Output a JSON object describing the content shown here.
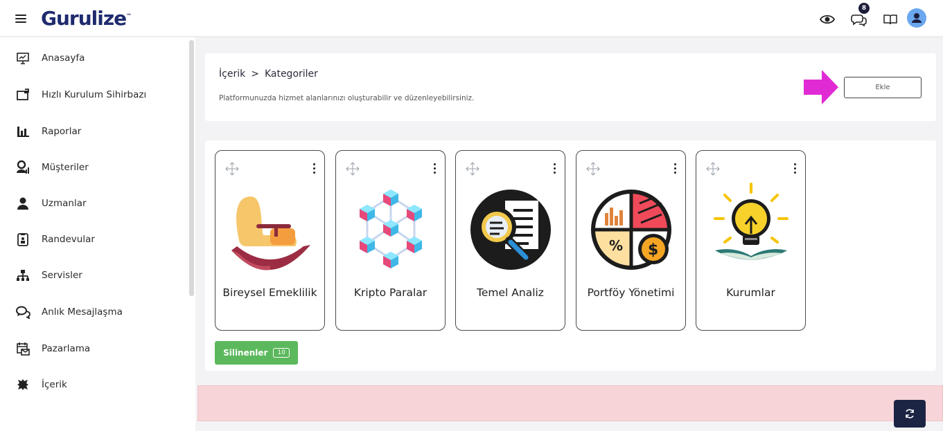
{
  "app": {
    "logo_text": "Gurulize",
    "logo_mark": "™"
  },
  "topbar": {
    "icons": [
      "menu-icon",
      "eye-icon",
      "chat-icon",
      "book-icon",
      "user-avatar"
    ],
    "chat_badge": "8"
  },
  "sidebar": {
    "items": [
      {
        "label": "Anasayfa",
        "icon": "dashboard-icon"
      },
      {
        "label": "Hızlı Kurulum Sihirbazı",
        "icon": "wizard-icon"
      },
      {
        "label": "Raporlar",
        "icon": "chart-icon"
      },
      {
        "label": "Müşteriler",
        "icon": "customers-icon"
      },
      {
        "label": "Uzmanlar",
        "icon": "experts-icon"
      },
      {
        "label": "Randevular",
        "icon": "appointments-icon"
      },
      {
        "label": "Servisler",
        "icon": "services-icon"
      },
      {
        "label": "Anlık Mesajlaşma",
        "icon": "messaging-icon"
      },
      {
        "label": "Pazarlama",
        "icon": "marketing-icon"
      },
      {
        "label": "İçerik",
        "icon": "content-icon"
      }
    ]
  },
  "header": {
    "breadcrumb_root": "İçerik",
    "breadcrumb_sep": ">",
    "breadcrumb_current": "Kategoriler",
    "description": "Platformunuzda hizmet alanlarınızı oluşturabilir ve düzenleyebilirsiniz.",
    "add_button": "Ekle"
  },
  "categories": [
    {
      "name": "Bireysel Emeklilik",
      "icon": "rocking-chair-icon"
    },
    {
      "name": "Kripto Paralar",
      "icon": "crypto-network-icon"
    },
    {
      "name": "Temel Analiz",
      "icon": "magnifier-document-icon"
    },
    {
      "name": "Portföy Yönetimi",
      "icon": "portfolio-pie-icon"
    },
    {
      "name": "Kurumlar",
      "icon": "lightbulb-book-icon"
    }
  ],
  "deleted": {
    "label": "Silinenler",
    "count": "10"
  },
  "colors": {
    "brand": "#1f2b6e",
    "accent_arrow": "#e02bd4",
    "deleted_btn": "#5cb85c",
    "alert_bg": "#f6d4d8",
    "refresh_btn": "#1c2444"
  }
}
